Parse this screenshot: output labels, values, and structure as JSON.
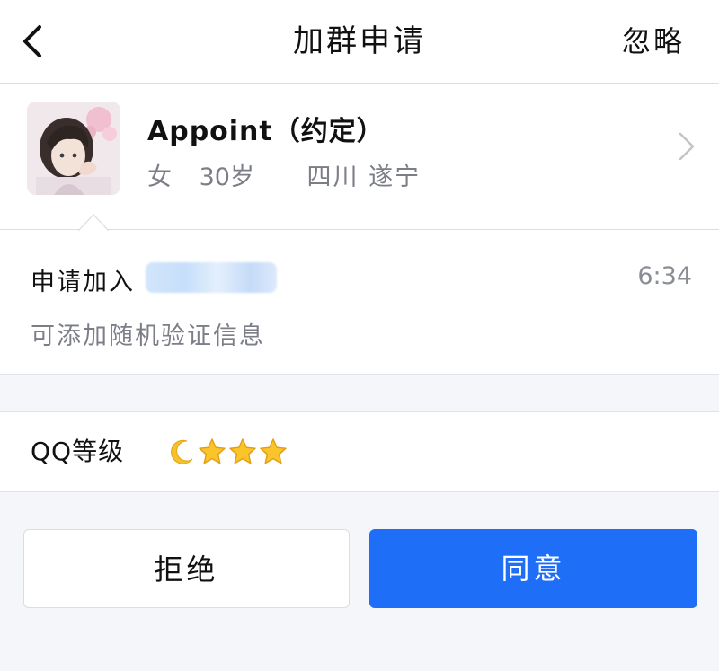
{
  "navbar": {
    "back_icon": "chevron-left-icon",
    "title": "加群申请",
    "ignore_label": "忽略"
  },
  "profile": {
    "avatar_icon": "user-avatar",
    "name": "Appoint（约定）",
    "gender": "女",
    "age": "30岁",
    "location": "四川 遂宁",
    "chevron_icon": "chevron-right-icon"
  },
  "request": {
    "prefix": "申请加入",
    "time": "6:34",
    "note": "可添加随机验证信息"
  },
  "level": {
    "label": "QQ等级",
    "icons": [
      "moon-icon",
      "star-icon",
      "star-icon",
      "star-icon"
    ]
  },
  "actions": {
    "reject_label": "拒绝",
    "accept_label": "同意"
  },
  "colors": {
    "accent": "#1f6ef8",
    "background": "#f5f6fa",
    "secondary_text": "#7b7e86"
  }
}
